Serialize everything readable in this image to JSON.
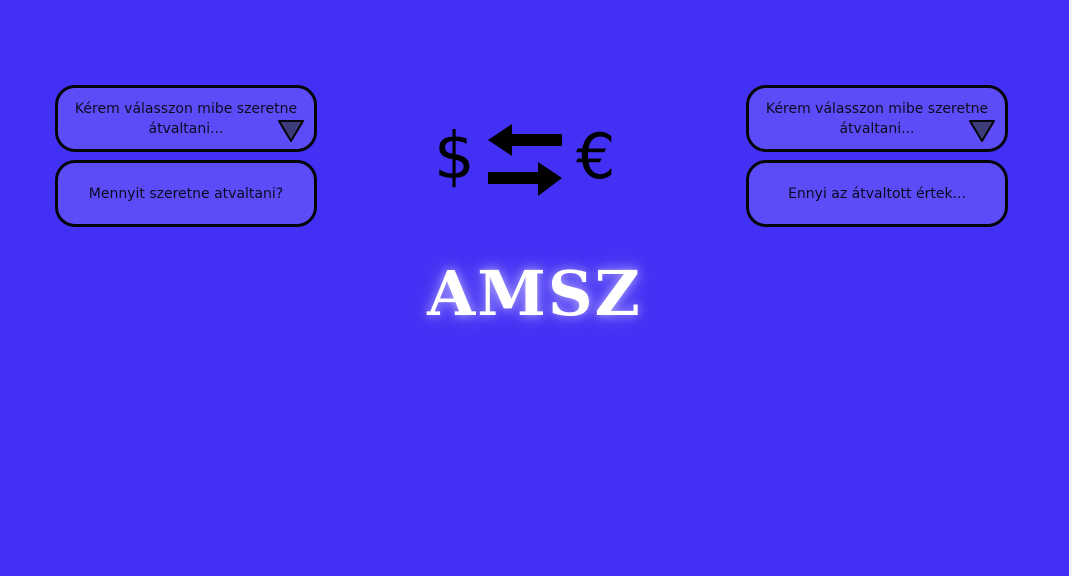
{
  "left_panel": {
    "currency_select": {
      "placeholder": "Kérem válasszon mibe szeretne átvaltani..."
    },
    "amount_field": {
      "placeholder": "Mennyit szeretne atvaltani?"
    }
  },
  "right_panel": {
    "currency_select": {
      "placeholder": "Kérem válasszon mibe szeretne átvaltani..."
    },
    "result_field": {
      "placeholder": "Ennyi az átvaltott értek..."
    }
  },
  "exchange_graphic": {
    "left_symbol": "$",
    "right_symbol": "€",
    "swap_icon": "swap-arrows-icon"
  },
  "brand": {
    "name": "AMSZ"
  },
  "colors": {
    "background": "#4230f4",
    "field_fill": "#5c4cf8",
    "field_border": "#050505",
    "caret_fill": "#3d3c7a",
    "brand_text": "#ffffff"
  }
}
